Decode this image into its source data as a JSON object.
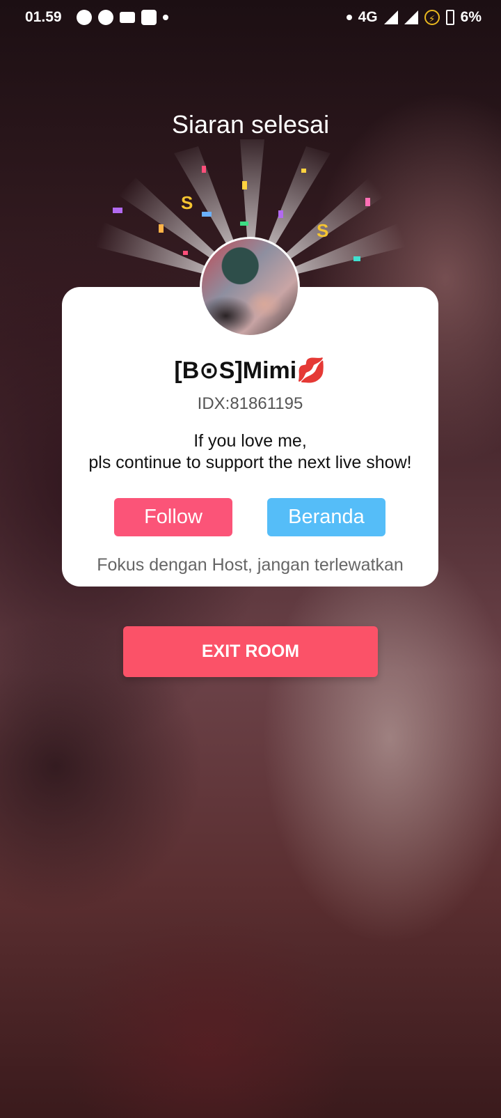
{
  "status_bar": {
    "time": "01.59",
    "network": "4G",
    "battery": "6%",
    "left_icons": [
      "speed-icon",
      "speed-icon",
      "video-icon",
      "shopping-bag-icon",
      "notification-dot-icon"
    ],
    "right_icons": [
      "dot-icon",
      "signal-icon",
      "signal-icon",
      "battery-saver-icon",
      "battery-icon"
    ]
  },
  "page": {
    "title": "Siaran selesai"
  },
  "host": {
    "name": "[B⊙S]Mimi💋",
    "idx": "IDX:81861195"
  },
  "card": {
    "message_line1": "If you love me,",
    "message_line2": "pls continue to support the next live show!",
    "follow_label": "Follow",
    "beranda_label": "Beranda",
    "note": "Fokus dengan Host, jangan terlewatkan"
  },
  "exit_label": "EXIT ROOM",
  "colors": {
    "follow": "#fb5478",
    "beranda": "#55bdf8",
    "exit": "#fb5268"
  }
}
